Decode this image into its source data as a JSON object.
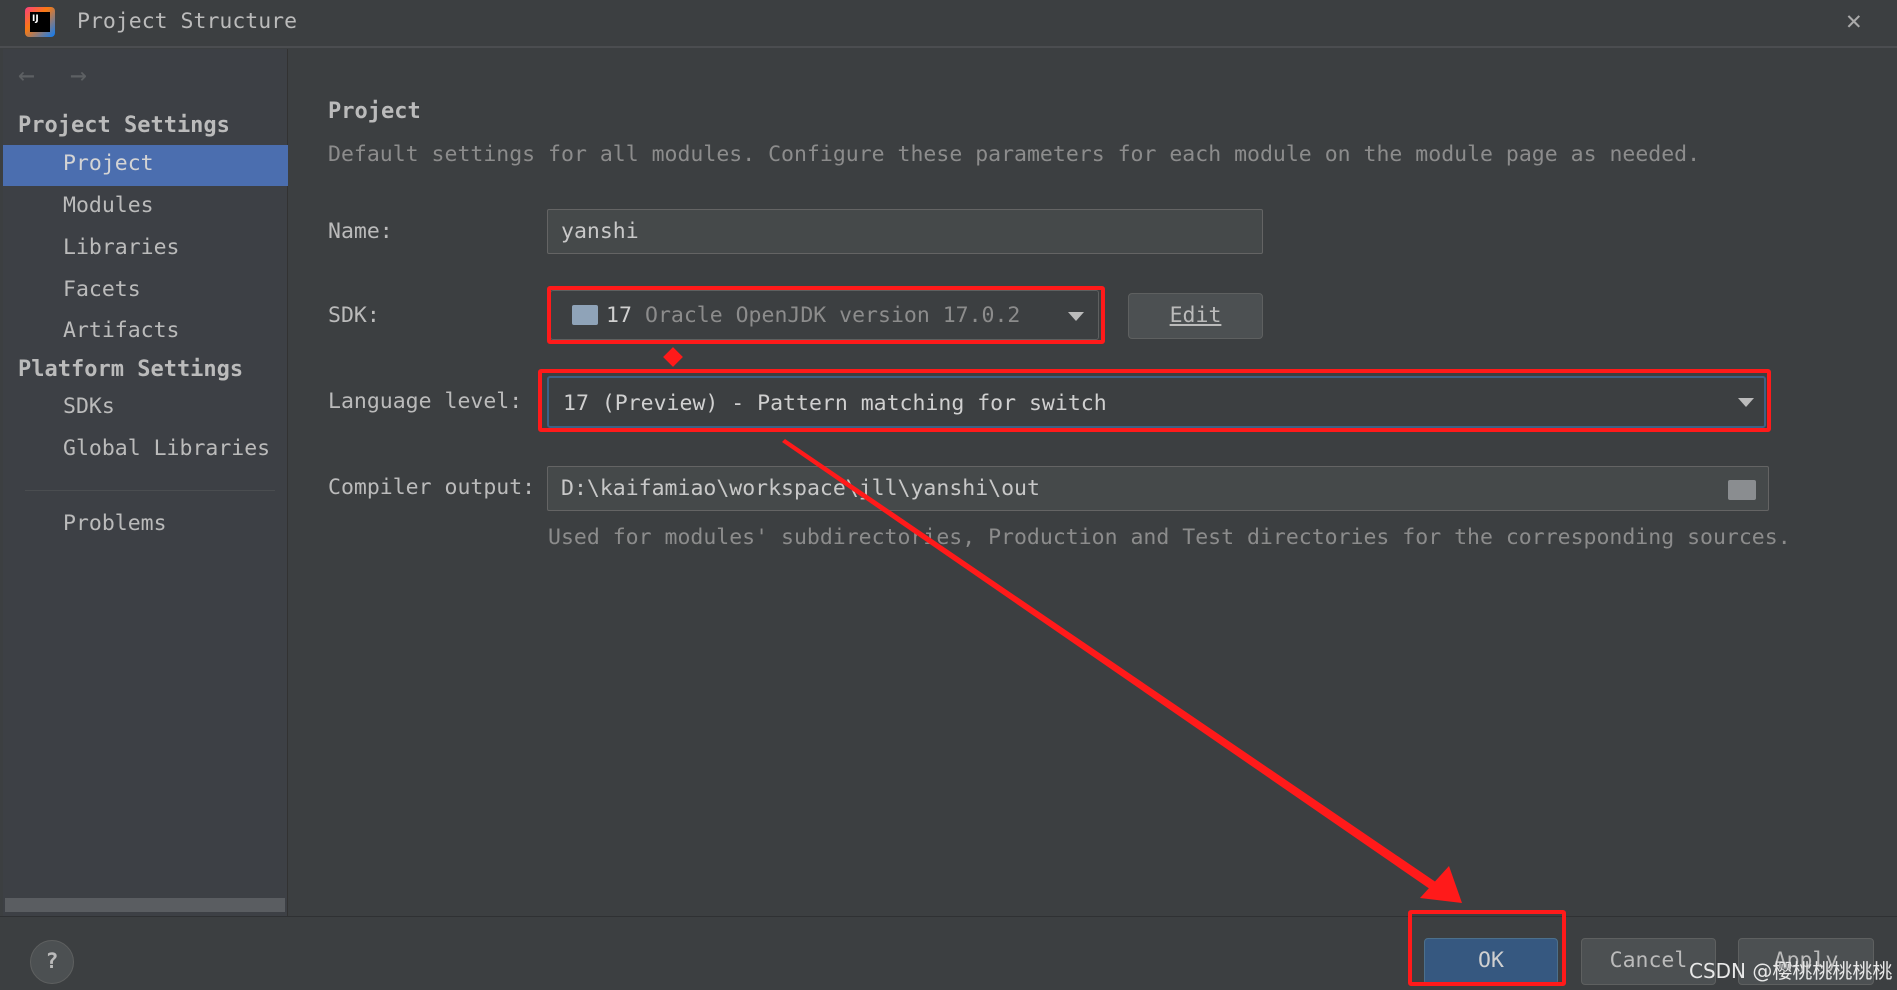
{
  "window": {
    "title": "Project Structure",
    "app_icon": "intellij-idea-icon",
    "close_icon": "close-icon"
  },
  "nav": {
    "back_icon": "arrow-left-icon",
    "forward_icon": "arrow-right-icon"
  },
  "sidebar": {
    "project_settings_header": "Project Settings",
    "project_items": [
      {
        "label": "Project",
        "selected": true
      },
      {
        "label": "Modules"
      },
      {
        "label": "Libraries"
      },
      {
        "label": "Facets"
      },
      {
        "label": "Artifacts"
      }
    ],
    "platform_settings_header": "Platform Settings",
    "platform_items": [
      {
        "label": "SDKs"
      },
      {
        "label": "Global Libraries"
      }
    ],
    "problems": "Problems"
  },
  "main": {
    "heading": "Project",
    "description": "Default settings for all modules. Configure these parameters for each module on the module page as needed.",
    "name_label": "Name:",
    "name_value": "yanshi",
    "sdk_label": "SDK:",
    "sdk_version": "17",
    "sdk_detail": "Oracle OpenJDK version 17.0.2",
    "edit_button": "Edit",
    "language_level_label": "Language level:",
    "language_level_value": "17 (Preview) - Pattern matching for switch",
    "compiler_output_label": "Compiler output:",
    "compiler_output_value": "D:\\kaifamiao\\workspace\\jll\\yanshi\\out",
    "compiler_output_hint": "Used for modules' subdirectories, Production and Test directories for the corresponding sources."
  },
  "footer": {
    "help": "?",
    "ok": "OK",
    "cancel": "Cancel",
    "apply": "Apply"
  },
  "watermark": "CSDN @樱桃桃桃桃桃",
  "colors": {
    "selection": "#4b6eaf",
    "annotation": "#ff1a1a",
    "ok_button": "#365880"
  }
}
